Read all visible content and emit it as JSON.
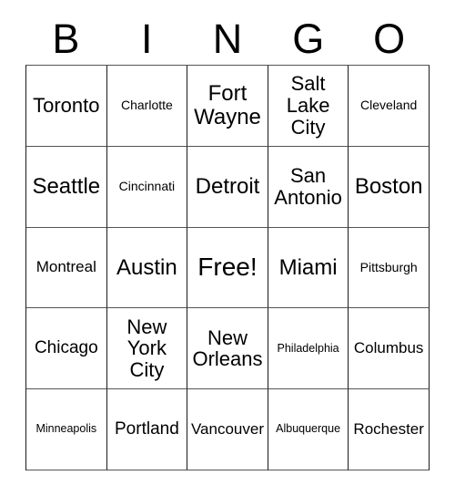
{
  "card": {
    "header_letters": [
      "B",
      "I",
      "N",
      "G",
      "O"
    ],
    "free_space_label": "Free!",
    "rows": [
      [
        {
          "label": "Toronto",
          "size": "lg"
        },
        {
          "label": "Charlotte",
          "size": "xs"
        },
        {
          "label": "Fort\nWayne",
          "size": "xl"
        },
        {
          "label": "Salt\nLake\nCity",
          "size": "lg"
        },
        {
          "label": "Cleveland",
          "size": "xs"
        }
      ],
      [
        {
          "label": "Seattle",
          "size": "xl"
        },
        {
          "label": "Cincinnati",
          "size": "xs"
        },
        {
          "label": "Detroit",
          "size": "xl"
        },
        {
          "label": "San\nAntonio",
          "size": "lg"
        },
        {
          "label": "Boston",
          "size": "xl"
        }
      ],
      [
        {
          "label": "Montreal",
          "size": "sm"
        },
        {
          "label": "Austin",
          "size": "xl"
        },
        {
          "label": "Free!",
          "size": "free"
        },
        {
          "label": "Miami",
          "size": "xl"
        },
        {
          "label": "Pittsburgh",
          "size": "xs"
        }
      ],
      [
        {
          "label": "Chicago",
          "size": "md"
        },
        {
          "label": "New\nYork\nCity",
          "size": "lg"
        },
        {
          "label": "New\nOrleans",
          "size": "lg"
        },
        {
          "label": "Philadelphia",
          "size": "xxs"
        },
        {
          "label": "Columbus",
          "size": "sm"
        }
      ],
      [
        {
          "label": "Minneapolis",
          "size": "xxs"
        },
        {
          "label": "Portland",
          "size": "md"
        },
        {
          "label": "Vancouver",
          "size": "sm"
        },
        {
          "label": "Albuquerque",
          "size": "xxs"
        },
        {
          "label": "Rochester",
          "size": "sm"
        }
      ]
    ]
  },
  "colors": {
    "background": "#ffffff",
    "text": "#000000",
    "grid_line_vertical": "#1a1a1a",
    "grid_line_horizontal": "#555555"
  }
}
